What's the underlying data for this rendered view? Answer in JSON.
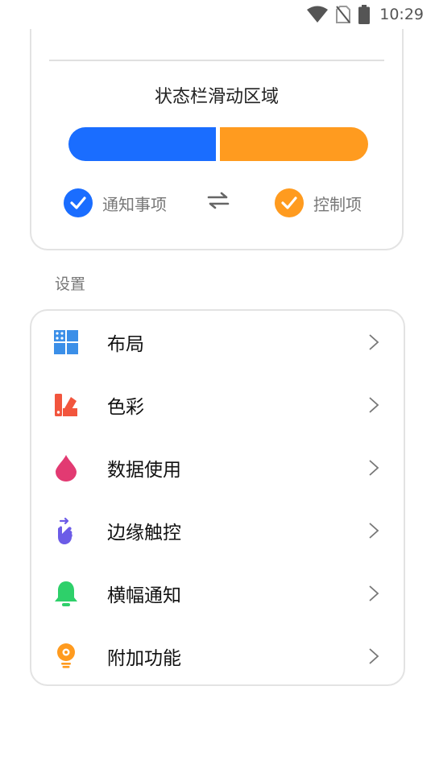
{
  "status_bar": {
    "time": "10:29",
    "icons": [
      "wifi-icon",
      "no-sim-icon",
      "battery-icon"
    ]
  },
  "status_zone": {
    "title": "状态栏滑动区域",
    "left_zone_color": "#1a6dff",
    "right_zone_color": "#ff9b1f",
    "legend": {
      "notification_label": "通知事项",
      "control_label": "控制项"
    }
  },
  "settings": {
    "section_label": "设置",
    "items": [
      {
        "label": "布局",
        "icon": "layout-grid-icon",
        "color": "#3b8fe8"
      },
      {
        "label": "色彩",
        "icon": "color-palette-icon",
        "color": "#f2553d"
      },
      {
        "label": "数据使用",
        "icon": "data-drop-icon",
        "color": "#e23a72"
      },
      {
        "label": "边缘触控",
        "icon": "edge-touch-icon",
        "color": "#6c5ce7"
      },
      {
        "label": "横幅通知",
        "icon": "bell-icon",
        "color": "#2ed06a"
      },
      {
        "label": "附加功能",
        "icon": "lightbulb-icon",
        "color": "#ff9b1f"
      }
    ]
  }
}
